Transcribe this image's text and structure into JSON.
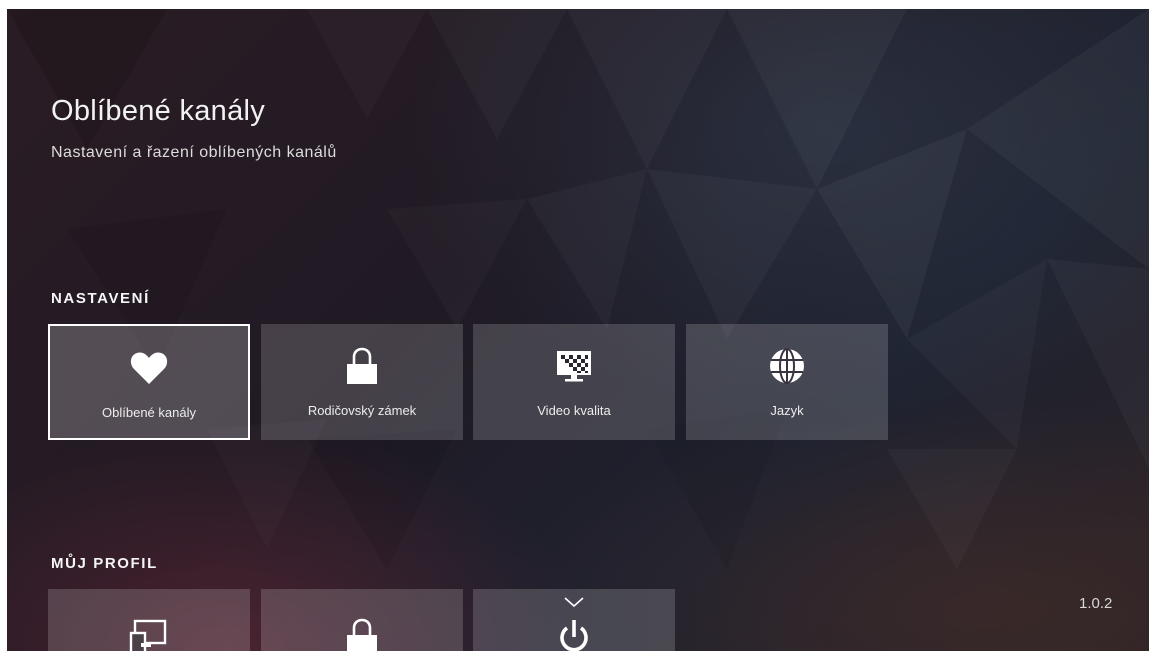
{
  "header": {
    "title": "Oblíbené kanály",
    "subtitle": "Nastavení a řazení oblíbených kanálů"
  },
  "sections": [
    {
      "heading": "NASTAVENÍ",
      "tiles": [
        {
          "label": "Oblíbené kanály",
          "icon": "heart-icon",
          "focused": true
        },
        {
          "label": "Rodičovský zámek",
          "icon": "padlock-icon",
          "focused": false
        },
        {
          "label": "Video kvalita",
          "icon": "video-quality-icon",
          "focused": false
        },
        {
          "label": "Jazyk",
          "icon": "globe-icon",
          "focused": false
        }
      ]
    },
    {
      "heading": "MŮJ PROFIL",
      "tiles": [
        {
          "icon": "devices-icon"
        },
        {
          "icon": "padlock-icon"
        },
        {
          "icon": "power-icon"
        }
      ]
    }
  ],
  "version": "1.0.2",
  "colors": {
    "text": "#f2f2f2",
    "tile_bg": "rgba(255,255,255,0.17)",
    "focus_border": "#ffffff"
  }
}
